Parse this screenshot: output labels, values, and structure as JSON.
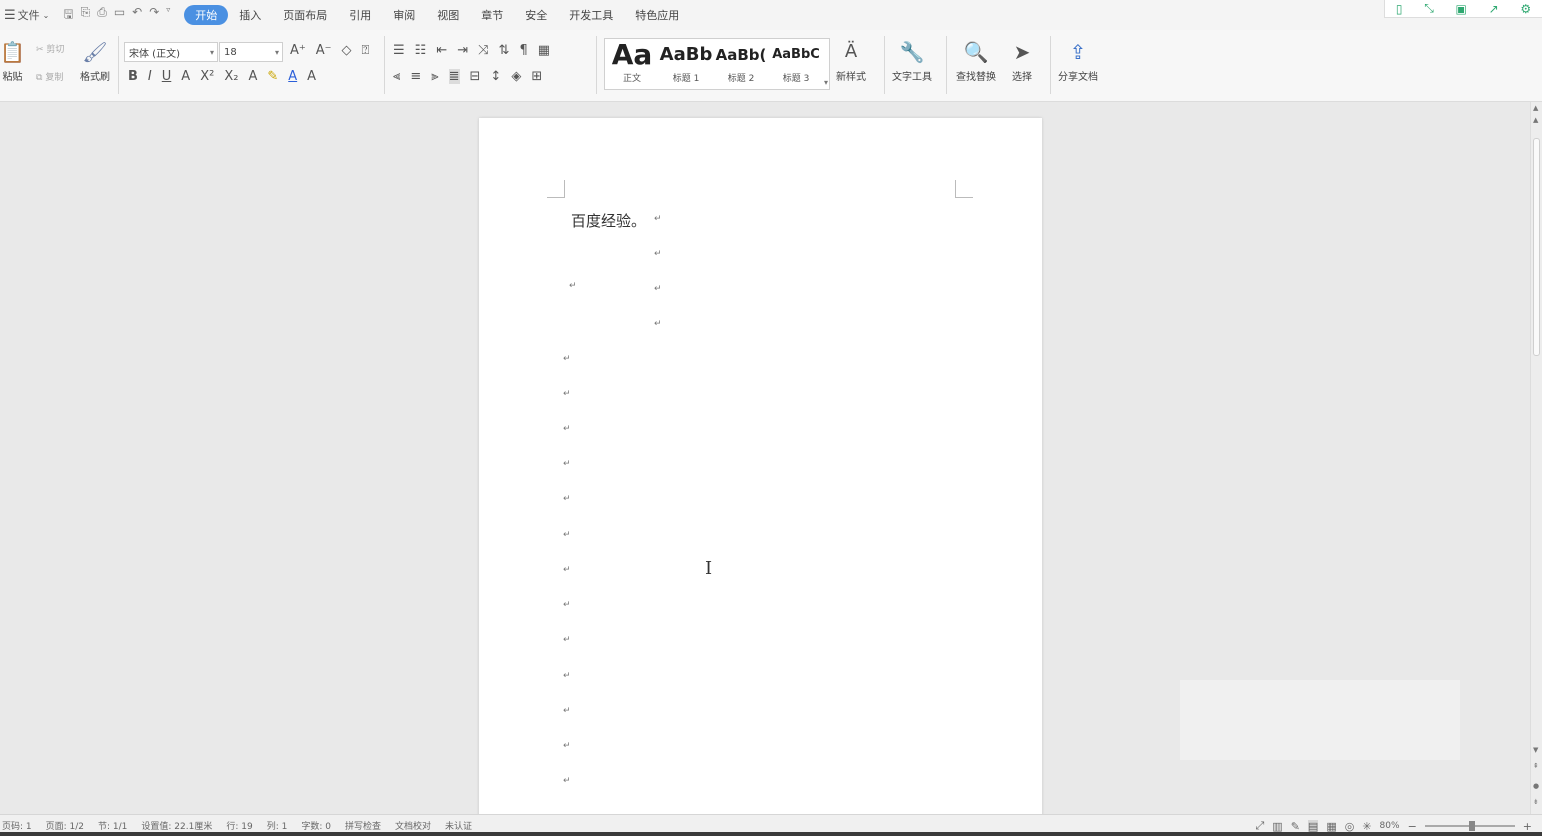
{
  "menubar": {
    "file_label": "文件",
    "tabs": [
      "开始",
      "插入",
      "页面布局",
      "引用",
      "审阅",
      "视图",
      "章节",
      "安全",
      "开发工具",
      "特色应用"
    ],
    "active_tab": "开始"
  },
  "ribbon": {
    "paste_label": "粘贴",
    "cut_label": "剪切",
    "copy_label": "复制",
    "format_painter_label": "格式刷",
    "font_name": "宋体 (正文)",
    "font_size": "18",
    "styles": [
      {
        "preview": "Aa",
        "name": "正文"
      },
      {
        "preview": "AaBb",
        "name": "标题 1"
      },
      {
        "preview": "AaBb(",
        "name": "标题 2"
      },
      {
        "preview": "AaBbC",
        "name": "标题 3"
      }
    ],
    "new_style_label": "新样式",
    "text_tools_label": "文字工具",
    "find_replace_label": "查找替换",
    "select_label": "选择",
    "share_label": "分享文档"
  },
  "document": {
    "first_line": "百度经验。"
  },
  "statusbar": {
    "page": "页码: 1",
    "pages": "页面: 1/2",
    "section": "节: 1/1",
    "position": "设置值: 22.1厘米",
    "row": "行: 19",
    "col": "列: 1",
    "words": "字数: 0",
    "spell": "拼写检查",
    "doc_check": "文档校对",
    "unverified": "未认证",
    "zoom": "80%"
  }
}
